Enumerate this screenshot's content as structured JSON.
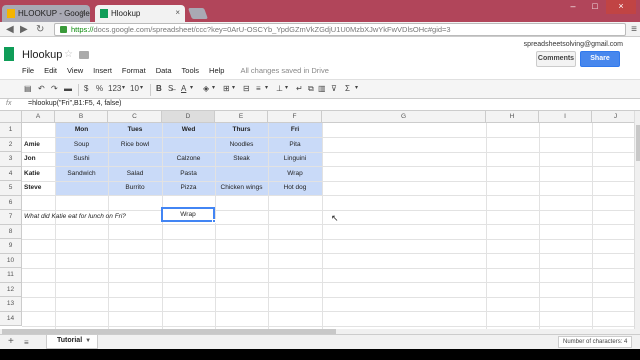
{
  "browser": {
    "tabs": [
      {
        "title": "HLOOKUP - Google Drive",
        "active": false
      },
      {
        "title": "Hlookup",
        "active": true
      }
    ],
    "url_scheme": "https://",
    "url_rest": "docs.google.com/spreadsheet/ccc?key=0ArU-OSCYb_YpdGZmVkZGdjU1U0MzbXJwYkFwVDlsOHc#gid=3"
  },
  "doc": {
    "title": "Hlookup",
    "account_email": "spreadsheetsolving@gmail.com",
    "comments_label": "Comments",
    "share_label": "Share",
    "menu": [
      "File",
      "Edit",
      "View",
      "Insert",
      "Format",
      "Data",
      "Tools",
      "Help"
    ],
    "save_status": "All changes saved in Drive"
  },
  "toolbar": {
    "currency": "$",
    "percent": "%",
    "number_format": "123",
    "font_size": "10",
    "bold": "B",
    "text_color_label": "A"
  },
  "formula_bar": {
    "fx_label": "fx",
    "formula": "=hlookup(\"Fri\",B1:F5, 4, false)"
  },
  "grid": {
    "columns": [
      "A",
      "B",
      "C",
      "D",
      "E",
      "F",
      "G",
      "H",
      "I",
      "J"
    ],
    "selected_column": "D",
    "rows": [
      "1",
      "2",
      "3",
      "4",
      "5",
      "6",
      "7",
      "8",
      "9",
      "10",
      "11",
      "12",
      "13",
      "14"
    ],
    "header_row": [
      "Mon",
      "Tues",
      "Wed",
      "Thurs",
      "Fri"
    ],
    "names": [
      "Amie",
      "Jon",
      "Katie",
      "Steve"
    ],
    "table": [
      [
        "Soup",
        "Rice bowl",
        "",
        "Noodles",
        "Pita"
      ],
      [
        "Sushi",
        "",
        "Calzone",
        "Steak",
        "Linguini"
      ],
      [
        "Sandwich",
        "Salad",
        "Pasta",
        "",
        "Wrap"
      ],
      [
        "",
        "Burrito",
        "Pizza",
        "Chicken wings",
        "Hot dog"
      ]
    ],
    "question": "What did Katie eat for lunch on Fri?",
    "answer": "Wrap"
  },
  "sheets": {
    "active_tab": "Tutorial",
    "count_label": "Number of characters: 4"
  }
}
